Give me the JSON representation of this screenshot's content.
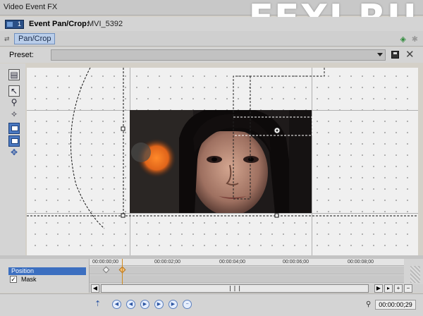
{
  "window": {
    "title": "Video Event FX"
  },
  "watermark": "EFXI.RU",
  "fx_bar": {
    "badge_number": "1",
    "label": "Event Pan/Crop:",
    "media_name": "MVI_5392"
  },
  "chain": {
    "plugin_name": "Pan/Crop"
  },
  "preset": {
    "label": "Preset:",
    "value": ""
  },
  "timeline": {
    "tracks": [
      {
        "label": "Position",
        "selected": true
      },
      {
        "label": "Mask",
        "checked": true
      }
    ],
    "ticks": [
      "00:00:00;00",
      "00:00:02;00",
      "00:00:04;00",
      "00:00:06;00",
      "00:00:08;00"
    ],
    "current_time": "00:00:00;29"
  },
  "icons": {
    "tools": [
      "properties-icon",
      "normal-edit-icon",
      "zoom-icon",
      "magic-wand-icon",
      "fit-canvas-icon",
      "center-icon",
      "move-icon"
    ],
    "transport": [
      "first-keyframe-icon",
      "prev-keyframe-icon",
      "play-icon",
      "next-keyframe-icon",
      "last-keyframe-icon",
      "add-keyframe-icon",
      "delete-keyframe-icon"
    ]
  },
  "colors": {
    "selection": "#3c6fc0",
    "plugin_chip": "#b9cde9",
    "badge": "#2a4f86"
  }
}
